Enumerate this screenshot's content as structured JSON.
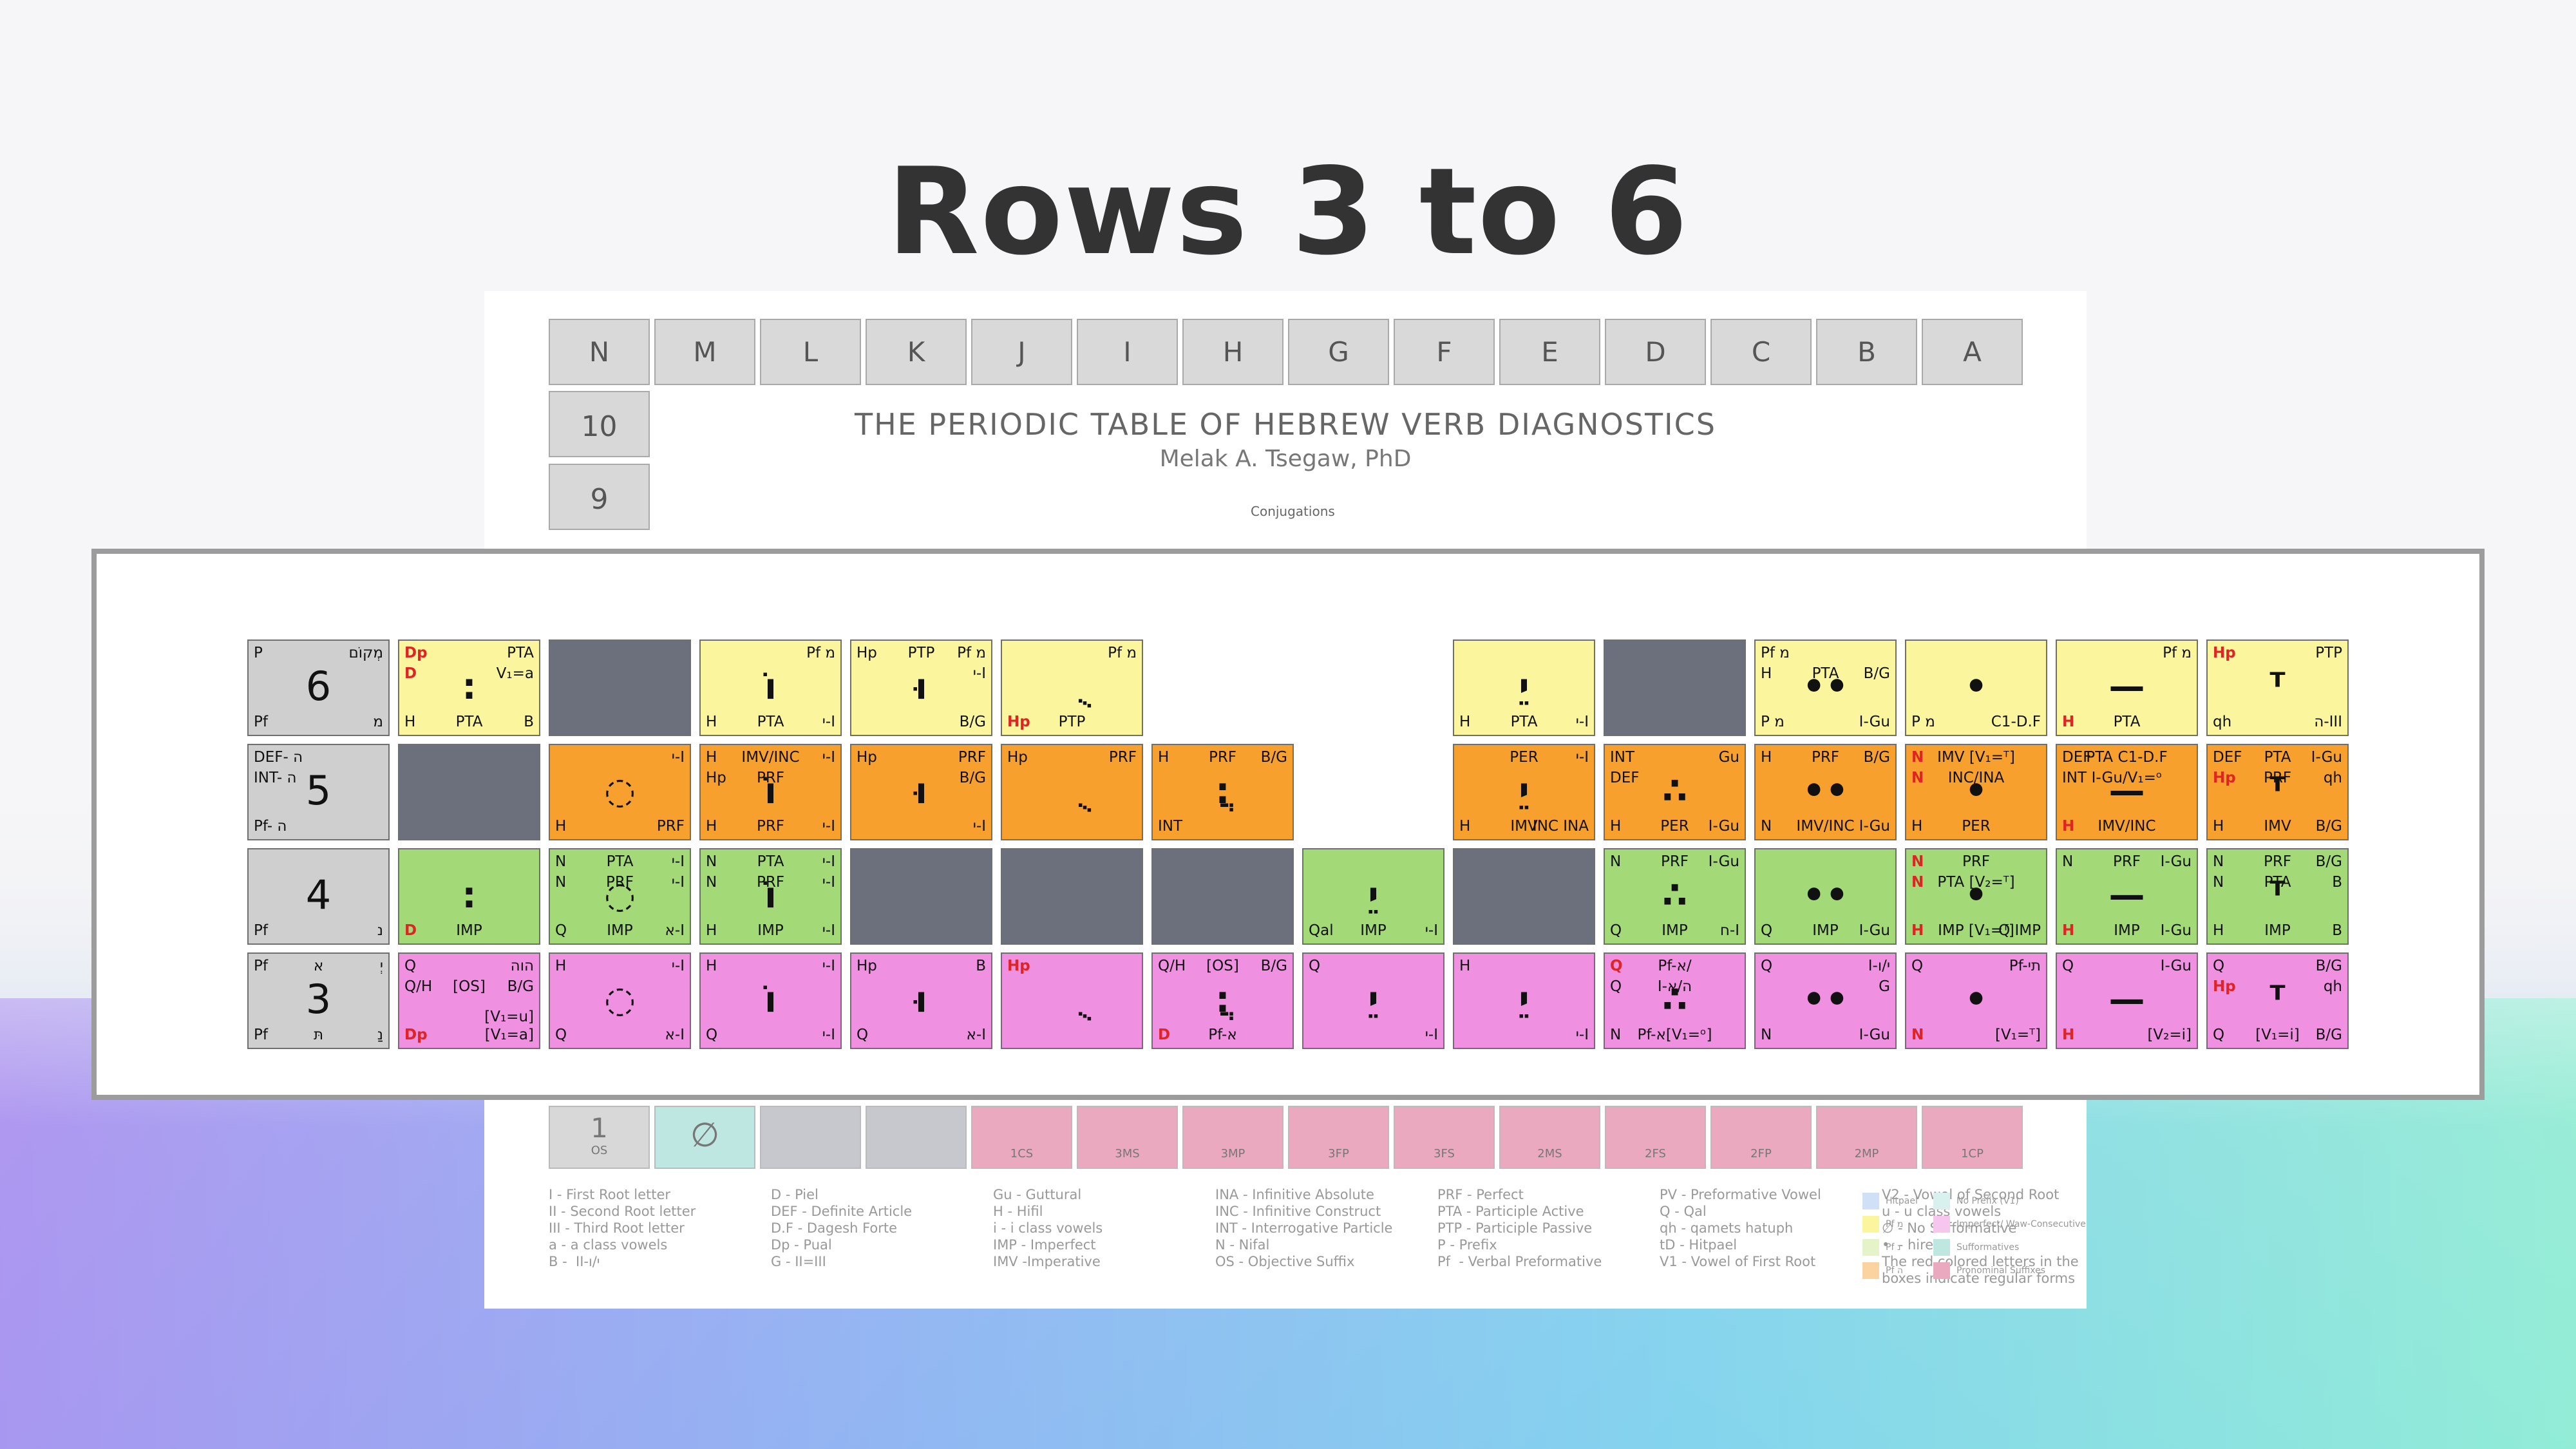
{
  "page_title": "Rows 3 to 6",
  "sheet": {
    "title": "THE PERIODIC TABLE OF HEBREW VERB DIAGNOSTICS",
    "author": "Melak A. Tsegaw, PhD",
    "conjugations_label": "Conjugations",
    "columns": [
      "N",
      "M",
      "L",
      "K",
      "J",
      "I",
      "H",
      "G",
      "F",
      "E",
      "D",
      "C",
      "B",
      "A"
    ],
    "row10_label": "10",
    "row9_label": "9",
    "row1_label": "1",
    "row1_sub": "OS",
    "bottom_labels": [
      "1CS",
      "3MS",
      "3MP",
      "3FP",
      "3FS",
      "2MS",
      "2FS",
      "2FP",
      "2MP",
      "1CP"
    ],
    "legend_cols": [
      "I - First Root letter\nII - Second Root letter\nIII - Third Root letter\na - a class vowels\nB -  II-י/ו",
      "D - Piel\nDEF - Definite Article\nD.F - Dagesh Forte\nDp - Pual\nG - II=III",
      "Gu - Guttural\nH - Hifil\ni - i class vowels\nIMP - Imperfect\nIMV -Imperative",
      "INA - Infinitive Absolute\nINC - Infinitive Construct\nINT - Interrogative Particle\nN - Nifal\nOS - Objective Suffix",
      "PRF - Perfect\nPTA - Participle Active\nPTP - Participle Passive\nP - Prefix\nPf  - Verbal Preformative",
      "PV - Preformative Vowel\nQ - Qal\nqh - qamets hatuph\ntD - Hitpael\nV1 - Vowel of First Root",
      "V2 - Vowel of Second Root\nu - u class vowels\n∅ - No Sufformative\n•  - hireq\nThe red colored letters in the\nboxes indicate regular forms"
    ],
    "legend_key": [
      "Hitpael",
      "Pf מ",
      "Pf נ",
      "Pf ה",
      "No Prefix (V1)",
      "Imperfect/ Waw-Consecutive",
      "Sufformatives",
      "Pronominal Suffixes"
    ],
    "colors": {
      "hitpael": "#cfe0f7",
      "pf_mem": "#fbf69d",
      "pf_nun": "#e5f3c9",
      "pf_he": "#fbd3a0",
      "no_prefix": "#d9f1ee",
      "imperfect": "#f6c6ee",
      "sufformatives": "#bfe7e2",
      "pronominal": "#eaa9bf"
    }
  },
  "rows": [
    {
      "id": "row6",
      "cells": [
        {
          "type": "row",
          "tl": "P",
          "tr": "מְקוֹם",
          "big": "6",
          "bl": "Pf",
          "br": "מ"
        },
        {
          "type": "yellow",
          "tl_red": "Dp",
          "tr": "PTA",
          "ml_red": "D",
          "mr": "V₁=a",
          "glyph": "׃",
          "bl": "H",
          "bm": "PTA",
          "br": "B"
        },
        {
          "type": "gray"
        },
        {
          "type": "yellow",
          "tr": "Pf מ",
          "glyph": "וֹ",
          "bl": "H",
          "bm": "PTA",
          "br": "י-I"
        },
        {
          "type": "yellow",
          "tl": "Hp",
          "tm": "PTP",
          "tr": "Pf מ",
          "glyph": "וּ",
          "mr": "י-I",
          "br": "B/G"
        },
        {
          "type": "yellow",
          "tr": "Pf מ",
          "glyph": "ֻ",
          "bl_red": "Hp",
          "bm": "PTP"
        },
        {
          "type": "empty"
        },
        {
          "type": "empty"
        },
        {
          "type": "yellow",
          "glyph": "יֵ",
          "bl": "H",
          "bm": "PTA",
          "br": "י-I"
        },
        {
          "type": "gray"
        },
        {
          "type": "yellow",
          "tl": "Pf מ",
          "ml": "H",
          "mm": "PTA",
          "mr": "B/G",
          "glyph": "••",
          "bl": "P מ",
          "br": "I-Gu"
        },
        {
          "type": "yellow",
          "glyph": "•",
          "bl": "P מ",
          "br": "C1-D.F"
        },
        {
          "type": "yellow",
          "tr": "Pf מ",
          "glyph": "—",
          "bl_red": "H",
          "bm": "PTA"
        },
        {
          "type": "yellow",
          "tl_red": "Hp",
          "tr": "PTP",
          "glyph": "ᵀ",
          "bl": "qh",
          "br": "ה-III"
        }
      ]
    },
    {
      "id": "row5",
      "cells": [
        {
          "type": "row",
          "tl": "DEF- ה",
          "ml": "INT- ה",
          "big": "5",
          "bl": "Pf- ה"
        },
        {
          "type": "gray"
        },
        {
          "type": "orange",
          "tr": "י-I",
          "glyph": "◌",
          "bl": "H",
          "br": "PRF"
        },
        {
          "type": "orange",
          "tl": "H",
          "tm": "IMV/INC",
          "tr": "י-I",
          "glyph": "וֹ",
          "ml": "Hp",
          "mm": "PRF",
          "bl": "H",
          "bm": "PRF",
          "br": "י-I"
        },
        {
          "type": "orange",
          "tl": "Hp",
          "tr": "PRF",
          "glyph": "וּ",
          "mr": "B/G",
          "br": "י-I"
        },
        {
          "type": "orange",
          "tl": "Hp",
          "tr": "PRF",
          "glyph": "ֻ"
        },
        {
          "type": "orange",
          "tl": "H",
          "tm": "PRF",
          "tr": "B/G",
          "glyph": "ֲ:",
          "bl": "INT"
        },
        {
          "type": "empty"
        },
        {
          "type": "orange",
          "tm": "PER",
          "tr": "י-I",
          "glyph": "יֵ",
          "bl": "H",
          "bm": "IMV",
          "br": "INC INA"
        },
        {
          "type": "orange",
          "tl": "INT",
          "ml": "DEF",
          "tr": "Gu",
          "glyph": "∴",
          "bl": "H",
          "bm": "PER",
          "br": "I-Gu"
        },
        {
          "type": "orange",
          "tl": "H",
          "tm": "PRF",
          "tr": "B/G",
          "glyph": "••",
          "bl": "N",
          "bm": "IMV/INC",
          "br": "I-Gu"
        },
        {
          "type": "orange",
          "tl_red": "N",
          "tm": "IMV [V₁=ᵀ]",
          "ml_red": "N",
          "mm": "INC/INA",
          "glyph": "•",
          "bl": "H",
          "bm": "PER"
        },
        {
          "type": "orange",
          "tl": "DEF",
          "tm": "PTA C1-D.F",
          "ml": "INT",
          "mm": "I-Gu/V₁=ᵒ",
          "glyph": "—",
          "bl_red": "H",
          "bm": "IMV/INC"
        },
        {
          "type": "orange",
          "tl": "DEF",
          "tm": "PTA",
          "tr": "I-Gu",
          "ml_red": "Hp",
          "mm": "PRF",
          "mr": "qh",
          "glyph": "ᵀ",
          "bl": "H",
          "bm": "IMV",
          "br": "B/G"
        }
      ]
    },
    {
      "id": "row4",
      "cells": [
        {
          "type": "row",
          "big": "4",
          "bl": "Pf",
          "br": "נ"
        },
        {
          "type": "green",
          "glyph": ":",
          "bl_red": "D",
          "bm": "IMP"
        },
        {
          "type": "green",
          "tl": "N",
          "tm": "PTA",
          "tr": "י-I",
          "ml": "N",
          "mm": "PRF",
          "mr": "י-I",
          "glyph": "◌",
          "bl": "Q",
          "bm": "IMP",
          "br": "א-I"
        },
        {
          "type": "green",
          "tl": "N",
          "tm": "PTA",
          "tr": "י-I",
          "ml": "N",
          "mm": "PRF",
          "mr": "י-I",
          "glyph": "וֹ",
          "bl": "H",
          "bm": "IMP",
          "br": "י-I"
        },
        {
          "type": "gray"
        },
        {
          "type": "gray"
        },
        {
          "type": "gray"
        },
        {
          "type": "green",
          "glyph": "יֵ",
          "bl": "Qal",
          "bm": "IMP",
          "br": "י-I"
        },
        {
          "type": "gray"
        },
        {
          "type": "green",
          "tl": "N",
          "tm": "PRF",
          "tr": "I-Gu",
          "glyph": "∴",
          "bl": "Q",
          "bm": "IMP",
          "br": "ח-I"
        },
        {
          "type": "green",
          "glyph": "••",
          "bl": "Q",
          "bm": "IMP",
          "br": "I-Gu"
        },
        {
          "type": "green",
          "tl_red": "N",
          "tm": "PRF",
          "ml_red": "N",
          "mm": "PTA [V₂=ᵀ]",
          "glyph": "•",
          "bl_red": "H",
          "bm": "IMP [V₁=ᵀ]",
          "br": "Q IMP"
        },
        {
          "type": "green",
          "tl": "N",
          "tm": "PRF",
          "tr": "I-Gu",
          "glyph": "—",
          "bl_red": "H",
          "bm": "IMP",
          "br": "I-Gu"
        },
        {
          "type": "green",
          "tl": "N",
          "tm": "PRF",
          "tr": "B/G",
          "ml": "N",
          "mm": "PTA",
          "mr": "B",
          "glyph": "ᵀ",
          "bl": "H",
          "bm": "IMP",
          "br": "B"
        }
      ]
    },
    {
      "id": "row3",
      "cells": [
        {
          "type": "row",
          "tl": "Pf",
          "tm": "א",
          "tr": "יְ",
          "big": "3",
          "bl": "Pf",
          "bm": "תּ",
          "br": "נַ"
        },
        {
          "type": "pink",
          "tl": "Q",
          "tr": "הוה",
          "ml": "Q/H",
          "mm": "[OS]",
          "mr": "B/G",
          "glyph": "",
          "bl_red": "Dp",
          "mr2": "[V₁=u]",
          "bm_red": "D",
          "br": "[V₁=a]"
        },
        {
          "type": "pink",
          "tl": "H",
          "tr": "י-I",
          "glyph": "◌",
          "bl": "Q",
          "br": "א-I"
        },
        {
          "type": "pink",
          "tl": "H",
          "tr": "י-I",
          "glyph": "וֹ",
          "bl": "Q",
          "br": "י-I"
        },
        {
          "type": "pink",
          "tl": "Hp",
          "tr": "B",
          "glyph": "וּ",
          "bl": "Q",
          "br": "א-I"
        },
        {
          "type": "pink",
          "tl_red": "Hp",
          "glyph": "ֻ"
        },
        {
          "type": "pink",
          "tl": "Q/H",
          "tm": "[OS]",
          "tr": "B/G",
          "glyph": "ֲ:",
          "bl_red": "D",
          "bm": "Pf-א"
        },
        {
          "type": "pink",
          "tl": "Q",
          "glyph": "יֵ",
          "br": "י-I"
        },
        {
          "type": "pink",
          "tl": "H",
          "glyph": "יֵ",
          "br": "י-I"
        },
        {
          "type": "pink",
          "tl_red": "Q",
          "tm": "Pf-א/",
          "ml": "Q",
          "mm": "I-ה/א",
          "glyph": "∴",
          "bl": "N",
          "bm": "Pf-א[V₁=ᵒ]"
        },
        {
          "type": "pink",
          "tl": "Q",
          "tr": "I-י/ו",
          "mr": "G",
          "glyph": "••",
          "bl": "N",
          "br": "I-Gu"
        },
        {
          "type": "pink",
          "tl": "Q",
          "tr": "Pf-תי",
          "glyph": "•",
          "bl_red": "N",
          "br": "[V₁=ᵀ]"
        },
        {
          "type": "pink",
          "tl": "Q",
          "tr": "I-Gu",
          "glyph": "—",
          "bl_red": "H",
          "br": "[V₂=i]"
        },
        {
          "type": "pink",
          "tl": "Q",
          "tr": "B/G",
          "glyph": "ᵀ",
          "ml_red": "Hp",
          "mr": "qh",
          "bl": "Q",
          "bm": "[V₁=i]",
          "br": "B/G"
        }
      ]
    }
  ]
}
